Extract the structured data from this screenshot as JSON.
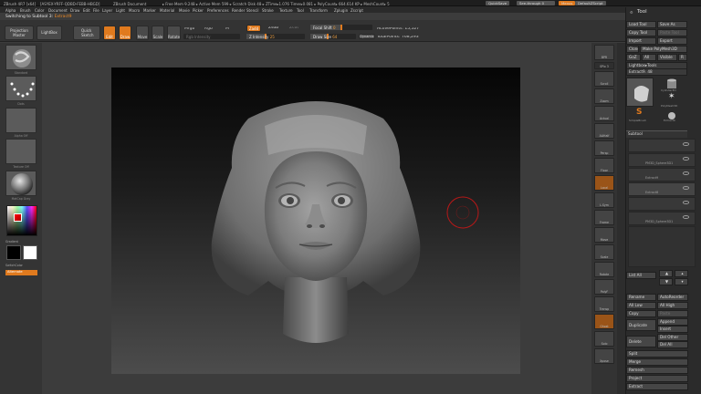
{
  "titlebar": {
    "app": "ZBrush 4R7 [x64]",
    "serial": "[ASYEX-YRFF-QDBD-FEBB-HBGD]",
    "doc": "ZBrush Document",
    "stats": "▸ Free Mem 9.248 ▸ Active Mem 599 ▸ Scratch Disk 48 ▸ ZTime▸1.076 Timer▸0.081 ▸ PolyCount▸ 664.614 KP ▸ MeshCount▸ 5",
    "quicksave": "QuickSave",
    "seethrough": "See-through  0",
    "menus": "Menus",
    "script": "DefaultZScript"
  },
  "menubar": [
    "Alpha",
    "Brush",
    "Color",
    "Document",
    "Draw",
    "Edit",
    "File",
    "Layer",
    "Light",
    "Macro",
    "Marker",
    "Material",
    "Movie",
    "Picker",
    "Preferences",
    "Render",
    "Stencil",
    "Stroke",
    "Texture",
    "Tool",
    "Transform",
    "Zplugin",
    "Zscript"
  ],
  "switching": {
    "prefix": "Switching to Subtool 3:",
    "name": "Extract9"
  },
  "toolbar": {
    "projection": "Projection Master",
    "lightbox": "LightBox",
    "quicksketch": "Quick Sketch",
    "edit": "Edit",
    "draw": "Draw",
    "move": "Move",
    "scale": "Scale",
    "rotate": "Rotate",
    "mrgb": "Mrgb",
    "rgb": "Rgb",
    "m": "M",
    "rgb_intensity": "Rgb Intensity",
    "zadd": "Zadd",
    "zsub": "Zsub",
    "zcut": "Zcut",
    "zintensity_label": "Z Intensity",
    "zintensity_value": "25",
    "focal_label": "Focal Shift",
    "focal_value": "0",
    "drawsize_label": "Draw Size",
    "drawsize_value": "64",
    "dynamic": "Dynamic",
    "active_points": "ActivePoints: 15,527",
    "total_points": "TotalPoints: 768,293"
  },
  "leftshelf": {
    "brush": "Standard",
    "stroke": "Dots",
    "alpha": "Alpha Off",
    "texture": "Texture Off",
    "material": "MatCap Gray",
    "gradient": "Gradient",
    "switchcolor": "SwitchColor",
    "alternate": "Alternate"
  },
  "righttools": [
    "BPR",
    "SPix 3",
    "Scroll",
    "Zoom",
    "Actual",
    "AAHalf",
    "Persp",
    "Floor",
    "Local",
    "L.Sym",
    "Frame",
    "Move",
    "Scale",
    "Rotate",
    "PolyF",
    "Transp",
    "Ghost",
    "Solo",
    "Xpose"
  ],
  "palette": {
    "title": "Tool",
    "load": "Load Tool",
    "saveas": "Save As",
    "copy": "Copy Tool",
    "paste": "Paste Tool",
    "import": "Import",
    "export": "Export",
    "clone": "Clone",
    "make": "Make PolyMesh3D",
    "goz": "GoZ",
    "all": "All",
    "visible": "Visible",
    "r": "R",
    "lightbox_tools": "Lightbox▸Tools",
    "current_tool": "Extract9. 48",
    "thumbs": [
      "Extract9",
      "Cylinder3D",
      "PM3D_Sphere3D",
      "SimpleBrush",
      "PolyMesh3D",
      "Extract9"
    ],
    "subtool_header": "Subtool",
    "subtools": [
      "PM3D_Sphere3D1",
      "Extract9",
      "Extract8",
      "PM3D_Sphere3D1"
    ],
    "listall": "List All",
    "actions": [
      "Rename",
      "AutoReorder",
      "All Low",
      "All High",
      "Copy",
      "Paste",
      "Duplicate",
      "Append",
      "Insert",
      "Delete",
      "Del Other",
      "Del All",
      "Split",
      "Merge",
      "Remesh",
      "Project",
      "Extract"
    ]
  },
  "colors": {
    "accent": "#e07a1e",
    "bg": "#3c3c3c"
  }
}
